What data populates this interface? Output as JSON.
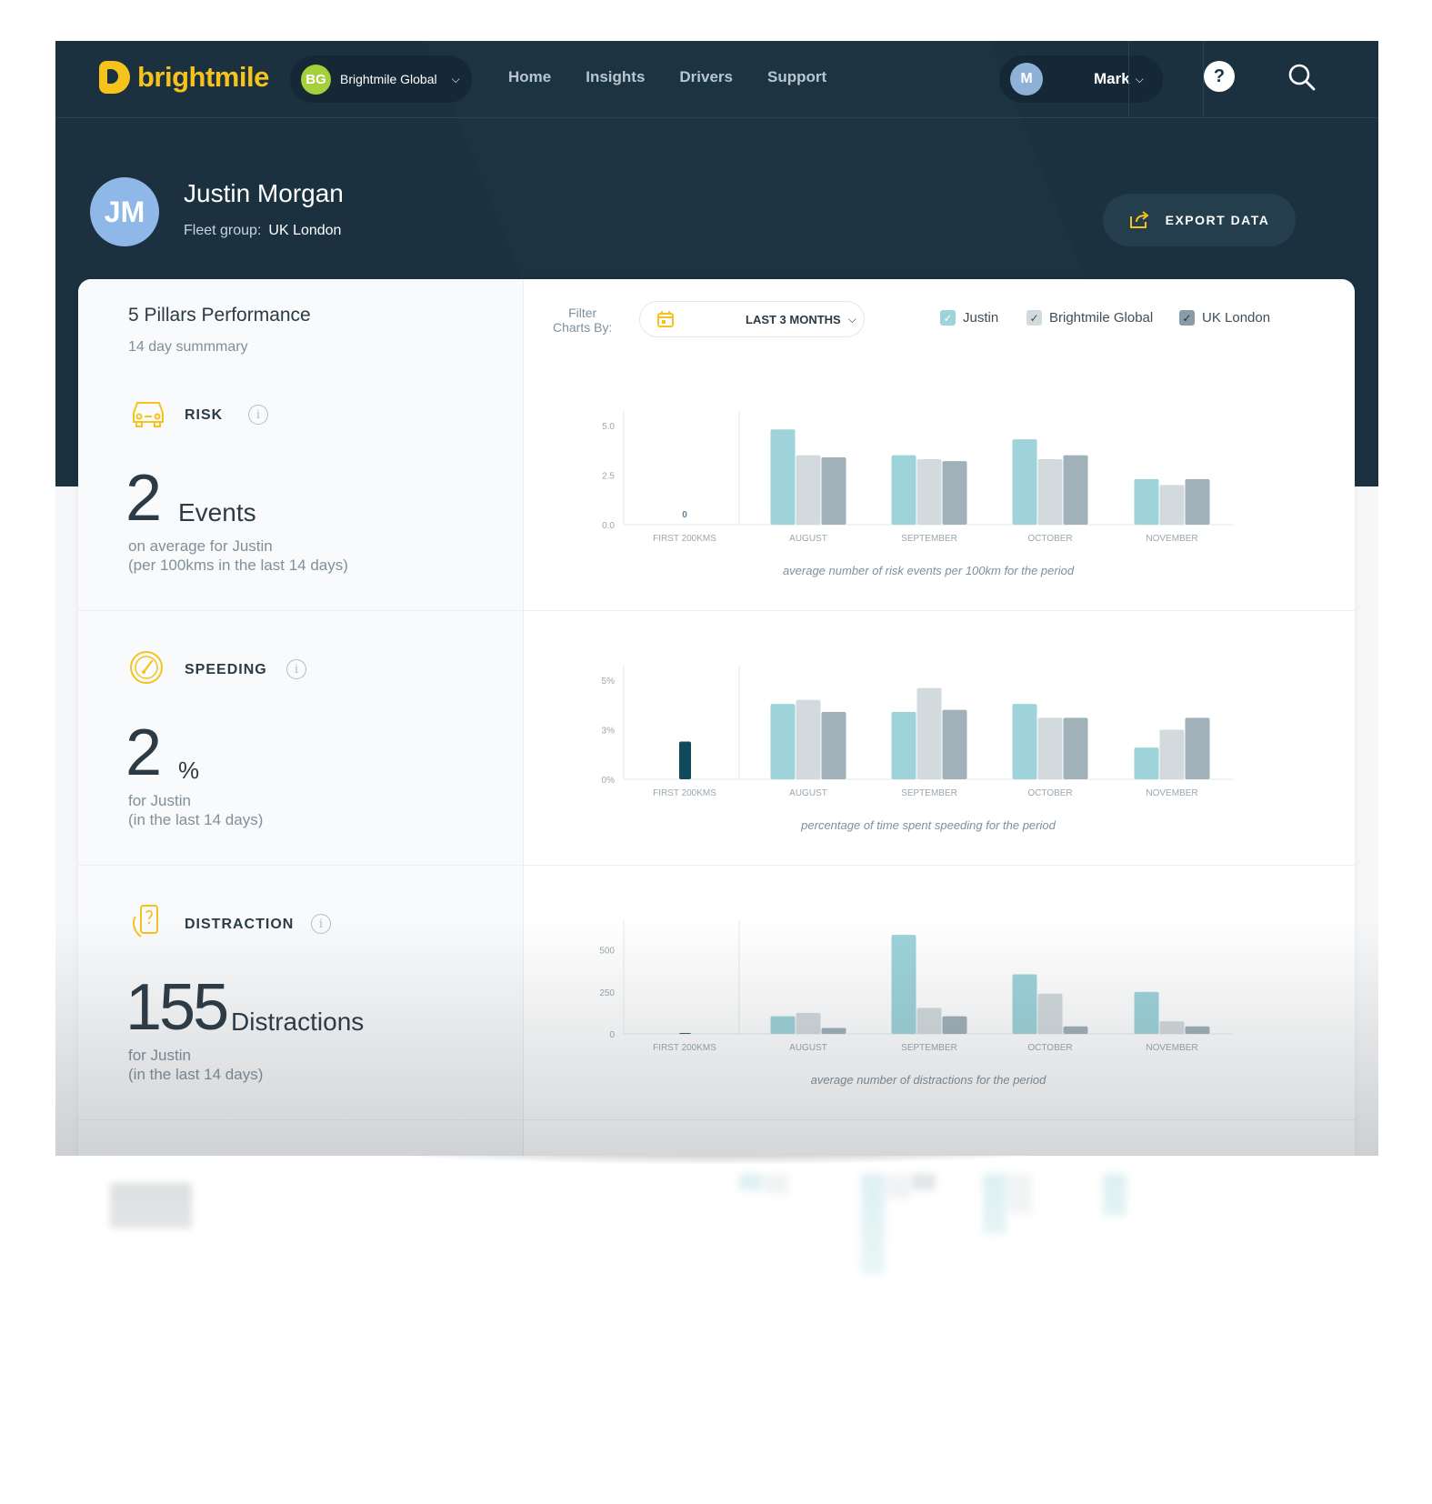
{
  "nav": {
    "logo_text": "brightmile",
    "org": {
      "badge": "BG",
      "name": "Brightmile Global"
    },
    "links": [
      "Home",
      "Insights",
      "Drivers",
      "Support"
    ],
    "user": {
      "initial": "M",
      "name": "Mark"
    },
    "help_glyph": "?"
  },
  "profile": {
    "initials": "JM",
    "name": "Justin Morgan",
    "fleet_label": "Fleet group:",
    "fleet_value": "UK London",
    "export_label": "EXPORT DATA"
  },
  "panel": {
    "title": "5 Pillars Performance",
    "subtitle": "14 day summmary",
    "filter_label_1": "Filter",
    "filter_label_2": "Charts By:",
    "filter_value": "LAST 3 MONTHS",
    "legend": [
      {
        "label": "Justin",
        "color": "#9dd3d9"
      },
      {
        "label": "Brightmile Global",
        "color": "#d3dadd"
      },
      {
        "label": "UK London",
        "color": "#8a9ca7"
      }
    ]
  },
  "colors": {
    "accent": "#f6c21c",
    "navy": "#1b3140",
    "series_justin": "#9dd3d9",
    "series_global": "#d3dadd",
    "series_london": "#a1b1b9",
    "first_bar": "#0f4a5c"
  },
  "pillars": [
    {
      "key": "risk",
      "name": "RISK",
      "icon": "car-icon",
      "value": "2",
      "unit": "Events",
      "note1": "on average for Justin",
      "note2": "(per 100kms in the last 14 days)"
    },
    {
      "key": "speeding",
      "name": "SPEEDING",
      "icon": "speedometer-icon",
      "value": "2",
      "unit": "%",
      "note1": "for Justin",
      "note2": "(in the last 14 days)"
    },
    {
      "key": "distraction",
      "name": "DISTRACTION",
      "icon": "phone-hand-icon",
      "value": "155",
      "unit": "Distractions",
      "note1": "for Justin",
      "note2": "(in the last 14 days)"
    }
  ],
  "chart_data": [
    {
      "type": "bar",
      "categories": [
        "FIRST 200KMS",
        "AUGUST",
        "SEPTEMBER",
        "OCTOBER",
        "NOVEMBER"
      ],
      "ticks": [
        "0.0",
        "2.5",
        "5.0"
      ],
      "ylim": [
        0,
        5.5
      ],
      "first_label": "0",
      "first_value": 0,
      "series": [
        {
          "name": "Justin",
          "values": [
            null,
            4.8,
            3.5,
            4.3,
            2.3
          ]
        },
        {
          "name": "Brightmile Global",
          "values": [
            null,
            3.5,
            3.3,
            3.3,
            2.0
          ]
        },
        {
          "name": "UK London",
          "values": [
            null,
            3.4,
            3.2,
            3.5,
            2.3
          ]
        }
      ],
      "caption": "average number of risk events per 100km for the period"
    },
    {
      "type": "bar",
      "categories": [
        "FIRST 200KMS",
        "AUGUST",
        "SEPTEMBER",
        "OCTOBER",
        "NOVEMBER"
      ],
      "ticks": [
        "0%",
        "3%",
        "5%"
      ],
      "tick_values": [
        0,
        2.5,
        5
      ],
      "ylim": [
        0,
        5.5
      ],
      "first_value": 1.9,
      "series": [
        {
          "name": "Justin",
          "values": [
            null,
            3.8,
            3.4,
            3.8,
            1.6
          ]
        },
        {
          "name": "Brightmile Global",
          "values": [
            null,
            4.0,
            4.6,
            3.1,
            2.5
          ]
        },
        {
          "name": "UK London",
          "values": [
            null,
            3.4,
            3.5,
            3.1,
            3.1
          ]
        }
      ],
      "caption": "percentage of time spent speeding for the period"
    },
    {
      "type": "bar",
      "categories": [
        "FIRST 200KMS",
        "AUGUST",
        "SEPTEMBER",
        "OCTOBER",
        "NOVEMBER"
      ],
      "ticks": [
        "0",
        "250",
        "500"
      ],
      "tick_values": [
        0,
        250,
        500
      ],
      "ylim": [
        0,
        650
      ],
      "first_value": 5,
      "series": [
        {
          "name": "Justin",
          "values": [
            null,
            105,
            590,
            355,
            250
          ]
        },
        {
          "name": "Brightmile Global",
          "values": [
            null,
            125,
            155,
            240,
            75
          ]
        },
        {
          "name": "UK London",
          "values": [
            null,
            35,
            105,
            45,
            45
          ]
        }
      ],
      "caption": "average number of distractions for the period"
    }
  ]
}
